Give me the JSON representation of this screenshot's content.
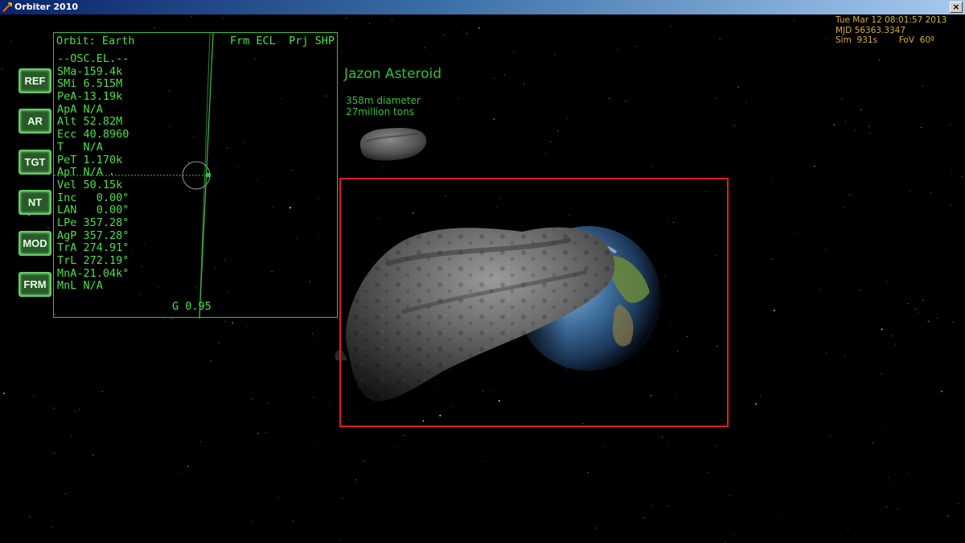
{
  "window": {
    "title": "Orbiter 2010",
    "close_glyph": "×"
  },
  "mfd": {
    "title": "Orbit: Earth",
    "frame_label": "Frm",
    "frame_value": "ECL",
    "proj_label": "Prj",
    "proj_value": "SHP",
    "section": "--OSC.EL.--",
    "elements": [
      "SMa-159.4k",
      "SMi 6.515M",
      "PeA-13.19k",
      "ApA N/A",
      "Alt 52.82M",
      "Ecc 40.8960",
      "T   N/A",
      "PeT 1.170k",
      "ApT N/A",
      "Vel 50.15k",
      "Inc   0.00°",
      "LAN   0.00°",
      "LPe 357.28°",
      "AgP 357.28°",
      "TrA 274.91°",
      "TrL 272.19°",
      "MnA-21.04k°",
      "MnL N/A"
    ],
    "footer": "G 0.95",
    "buttons": [
      "REF",
      "AR",
      "TGT",
      "NT",
      "MOD",
      "FRM"
    ]
  },
  "target": {
    "name": "Jazon Asteroid",
    "diameter": "358m diameter",
    "mass": "27million tons"
  },
  "hud": {
    "date": "Tue Mar 12 08:01:57 2013",
    "mjd": "MJD 56363.3347",
    "sim": "Sim  931s",
    "fov": "FoV  60º"
  },
  "colors": {
    "mfd_green": "#48e048",
    "hud_yellow": "#d7b226",
    "selection_red": "#e01a22",
    "label_green": "#32c232"
  }
}
